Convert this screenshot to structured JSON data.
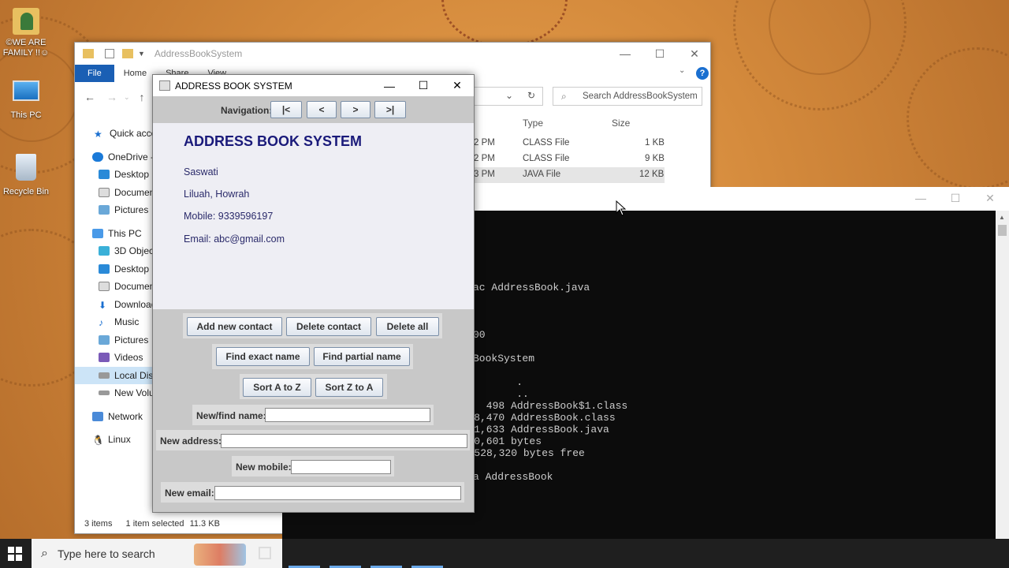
{
  "desktop": {
    "icons": [
      {
        "label": "©WE ARE FAMILY !!☺"
      },
      {
        "label": "This PC"
      },
      {
        "label": "Recycle Bin"
      }
    ]
  },
  "explorer": {
    "title": "AddressBookSystem",
    "ribbon_tabs": [
      "File",
      "Home",
      "Share",
      "View"
    ],
    "search_placeholder": "Search AddressBookSystem",
    "columns": {
      "type": "Type",
      "size": "Size"
    },
    "files": [
      {
        "time": "2 PM",
        "type": "CLASS File",
        "size": "1 KB"
      },
      {
        "time": "2 PM",
        "type": "CLASS File",
        "size": "9 KB"
      },
      {
        "time": "3 PM",
        "type": "JAVA File",
        "size": "12 KB"
      }
    ],
    "sidebar": [
      {
        "label": "Quick acces"
      },
      {
        "label": "OneDrive -"
      },
      {
        "label": "Desktop"
      },
      {
        "label": "Documen"
      },
      {
        "label": "Pictures"
      },
      {
        "label": "This PC"
      },
      {
        "label": "3D Object"
      },
      {
        "label": "Desktop"
      },
      {
        "label": "Documen"
      },
      {
        "label": "Download"
      },
      {
        "label": "Music"
      },
      {
        "label": "Pictures"
      },
      {
        "label": "Videos"
      },
      {
        "label": "Local Disk"
      },
      {
        "label": "New Volur"
      },
      {
        "label": "Network"
      },
      {
        "label": "Linux"
      }
    ],
    "status": {
      "items": "3 items",
      "selected": "1 item selected",
      "size": "11.3 KB"
    }
  },
  "console": {
    "lines": [
      "ac AddressBook.java",
      "00",
      "BookSystem",
      "         .",
      "         ..",
      "      498 AddressBook$1.class",
      "    8,470 AddressBook.class",
      "   11,633 AddressBook.java",
      "   20,601 bytes",
      "  ,528,320 bytes free",
      "a AddressBook"
    ]
  },
  "addressbook": {
    "title": "ADDRESS BOOK SYSTEM",
    "nav_label": "Navigation:",
    "nav_buttons": [
      "|<",
      "<",
      ">",
      ">|"
    ],
    "heading": "ADDRESS BOOK SYSTEM",
    "contact": {
      "name": "Saswati",
      "address": "Liluah, Howrah",
      "mobile": "Mobile: 9339596197",
      "email": "Email: abc@gmail.com"
    },
    "buttons": {
      "add": "Add new contact",
      "delete": "Delete contact",
      "delete_all": "Delete all",
      "find_exact": "Find exact name",
      "find_partial": "Find partial name",
      "sort_az": "Sort A to Z",
      "sort_za": "Sort Z to A"
    },
    "fields": {
      "name_label": "New/find name:",
      "address_label": "New address:",
      "mobile_label": "New mobile:",
      "email_label": "New email:",
      "name_value": "",
      "address_value": "",
      "mobile_value": "",
      "email_value": ""
    }
  },
  "taskbar": {
    "search_placeholder": "Type here to search"
  },
  "colors": {
    "desktop": "#d48a3c",
    "accent": "#1a5fb4",
    "heading": "#1a1a7a"
  }
}
